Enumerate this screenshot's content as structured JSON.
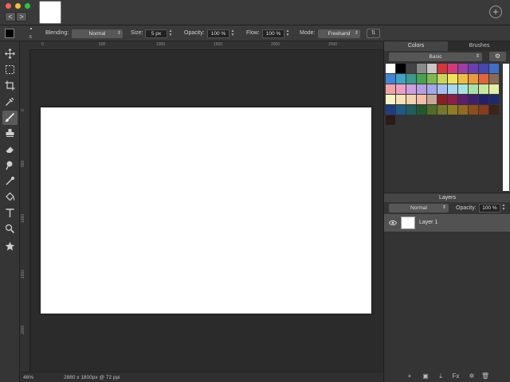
{
  "window": {
    "nav_back": "<",
    "nav_forward": ">",
    "add_document": "+"
  },
  "options_bar": {
    "brush_size_preview": "5",
    "blending_label": "Blending:",
    "blending_value": "Normal",
    "size_label": "Size:",
    "size_value": "5 px",
    "opacity_label": "Opacity:",
    "opacity_value": "100 %",
    "flow_label": "Flow:",
    "flow_value": "100 %",
    "mode_label": "Mode:",
    "mode_value": "Freehand",
    "foreground_color": "#000000"
  },
  "toolbar": {
    "tools": [
      {
        "name": "move-tool",
        "icon": "move-icon"
      },
      {
        "name": "marquee-tool",
        "icon": "marquee-icon"
      },
      {
        "name": "crop-tool",
        "icon": "crop-icon"
      },
      {
        "name": "eyedropper-tool",
        "icon": "eyedropper-icon"
      },
      {
        "name": "brush-tool",
        "icon": "brush-icon",
        "active": true
      },
      {
        "name": "stamp-tool",
        "icon": "stamp-icon"
      },
      {
        "name": "eraser-tool",
        "icon": "eraser-icon"
      },
      {
        "name": "smudge-tool",
        "icon": "smudge-icon"
      },
      {
        "name": "retouch-tool",
        "icon": "retouch-icon"
      },
      {
        "name": "fill-tool",
        "icon": "bucket-icon"
      },
      {
        "name": "text-tool",
        "icon": "text-icon"
      },
      {
        "name": "zoom-tool",
        "icon": "zoom-icon"
      },
      {
        "name": "favorite-tool",
        "icon": "star-icon"
      }
    ]
  },
  "rulers": {
    "horizontal": [
      "0",
      "500",
      "1000",
      "1500",
      "2000",
      "2500"
    ],
    "vertical": [
      "0",
      "500",
      "1000",
      "1500",
      "2000"
    ]
  },
  "status": {
    "zoom": "46%",
    "document_info": "2880 x 1800px @ 72 ppi"
  },
  "panel": {
    "tab_colors": "Colors",
    "tab_brushes": "Brushes",
    "palette_name": "Basic",
    "swatches": [
      "#ffffff",
      "#000000",
      "#444444",
      "#8a8a8a",
      "#c8c8c8",
      "#d8353a",
      "#d43a7b",
      "#9b3ea8",
      "#6b3fb0",
      "#4448b0",
      "#3f6fc9",
      "#3f86d6",
      "#3ea3c7",
      "#3a9a8e",
      "#47a24e",
      "#7cba50",
      "#c9d55a",
      "#f2e25a",
      "#efbd43",
      "#ea9a3c",
      "#e2653a",
      "#8a6a58",
      "#f2a3a6",
      "#ef9fc5",
      "#cfa0dd",
      "#b4a0e0",
      "#a3a8e6",
      "#a4c0ef",
      "#a6d8ef",
      "#a5e5dd",
      "#a8e2a5",
      "#c6e8a0",
      "#e4efa3",
      "#f8f4c0",
      "#f7e3b3",
      "#f6d3b0",
      "#f3bfa9",
      "#c9a89a",
      "#8c1d25",
      "#8b1e4b",
      "#5d1f6b",
      "#3e1f6e",
      "#241f6a",
      "#1c2a6e",
      "#1f3e7e",
      "#1f5a86",
      "#1f5e5a",
      "#22582b",
      "#4f6d24",
      "#76772a",
      "#8f7d25",
      "#8f6a20",
      "#8d4e1e",
      "#8a3a1d",
      "#3b2418",
      "#2b1a18"
    ],
    "layers_title": "Layers",
    "layer_blend": "Normal",
    "layer_opacity_label": "Opacity:",
    "layer_opacity_value": "100 %",
    "layers": [
      {
        "name": "Layer 1",
        "visible": true
      }
    ],
    "footer": {
      "fx_label": "Fx"
    }
  }
}
